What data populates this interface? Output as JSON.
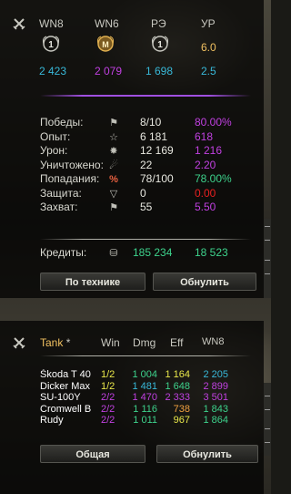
{
  "colors": {
    "white": "#e8e8e0",
    "green": "#3dd28c",
    "yellow": "#e8e64a",
    "purple": "#c040e0",
    "cyan": "#38b8d8",
    "red": "#e82020",
    "orange": "#f0a040",
    "header_yellow": "#f0c060"
  },
  "top": {
    "headers": [
      "WN8",
      "WN6",
      "РЭ",
      "УР"
    ],
    "values": [
      "2 423",
      "2 079",
      "1 698",
      "2.5"
    ],
    "ur_value": "6.0"
  },
  "stats": [
    {
      "label": "Победы:",
      "icon": "flag-icon",
      "v1": "8/10",
      "v2": "80.00%",
      "v2_color": "purple"
    },
    {
      "label": "Опыт:",
      "icon": "star-icon",
      "v1": "6 181",
      "v2": "618",
      "v2_color": "purple"
    },
    {
      "label": "Урон:",
      "icon": "explosion-icon",
      "v1": "12 169",
      "v2": "1 216",
      "v2_color": "purple"
    },
    {
      "label": "Уничтожено:",
      "icon": "tank-destroyed-icon",
      "v1": "22",
      "v2": "2.20",
      "v2_color": "purple"
    },
    {
      "label": "Попадания:",
      "icon": "percent-icon",
      "v1": "78/100",
      "v2": "78.00%",
      "v2_color": "green"
    },
    {
      "label": "Защита:",
      "icon": "shield-icon",
      "v1": "0",
      "v2": "0.00",
      "v2_color": "red"
    },
    {
      "label": "Захват:",
      "icon": "capture-icon",
      "v1": "55",
      "v2": "5.50",
      "v2_color": "purple"
    }
  ],
  "credits": {
    "label": "Кредиты:",
    "icon": "coins-icon",
    "v1": "185 234",
    "v2": "18 523"
  },
  "buttons1": {
    "by_vehicle": "По технике",
    "reset": "Обнулить"
  },
  "table": {
    "headers": {
      "tank": "Tank",
      "tank_suffix": "*",
      "win": "Win",
      "dmg": "Dmg",
      "eff": "Eff",
      "wn8": "WN8"
    },
    "rows": [
      {
        "name": "Škoda T 40",
        "win": "1/2",
        "win_color": "yellow",
        "dmg": "1 004",
        "dmg_color": "green",
        "eff": "1 164",
        "eff_color": "yellow",
        "wn8": "2 205",
        "wn8_color": "cyan"
      },
      {
        "name": "Dicker Max",
        "win": "1/2",
        "win_color": "yellow",
        "dmg": "1 481",
        "dmg_color": "cyan",
        "eff": "1 648",
        "eff_color": "green",
        "wn8": "2 899",
        "wn8_color": "purple"
      },
      {
        "name": "SU-100Y",
        "win": "2/2",
        "win_color": "purple",
        "dmg": "1 470",
        "dmg_color": "purple",
        "eff": "2 333",
        "eff_color": "purple",
        "wn8": "3 501",
        "wn8_color": "purple"
      },
      {
        "name": "Cromwell B",
        "win": "2/2",
        "win_color": "purple",
        "dmg": "1 116",
        "dmg_color": "green",
        "eff": "738",
        "eff_color": "orange",
        "wn8": "1 843",
        "wn8_color": "green"
      },
      {
        "name": "Rudy",
        "win": "2/2",
        "win_color": "purple",
        "dmg": "1 011",
        "dmg_color": "green",
        "eff": "967",
        "eff_color": "yellow",
        "wn8": "1 864",
        "wn8_color": "green"
      }
    ]
  },
  "buttons2": {
    "general": "Общая",
    "reset": "Обнулить"
  }
}
